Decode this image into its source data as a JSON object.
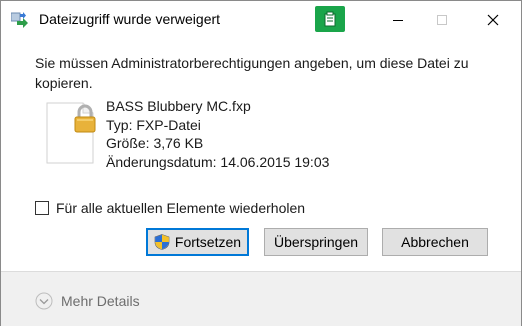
{
  "window": {
    "title": "Dateizugriff wurde verweigert",
    "caption_buttons": {
      "minimize": "─",
      "maximize": "☐",
      "close": "✕"
    }
  },
  "message": "Sie müssen Administratorberechtigungen angeben, um diese Datei zu kopieren.",
  "file": {
    "name": "BASS Blubbery MC.fxp",
    "type": "Typ: FXP-Datei",
    "size": "Größe: 3,76 KB",
    "modified": "Änderungsdatum: 14.06.2015 19:03"
  },
  "checkbox": {
    "label": "Für alle aktuellen Elemente wiederholen",
    "checked": false
  },
  "buttons": {
    "continue": "Fortsetzen",
    "skip": "Überspringen",
    "cancel": "Abbrechen"
  },
  "footer": {
    "more_details": "Mehr Details"
  },
  "colors": {
    "accent": "#0078d7",
    "green_tab": "#1aa54a",
    "lock": "#e8b23a",
    "footer_bg": "#f0f0f0"
  },
  "icons": [
    "copy-arrows-icon",
    "clipboard-icon",
    "minimize-icon",
    "maximize-icon",
    "close-icon",
    "file-icon",
    "lock-icon",
    "uac-shield-icon",
    "chevron-down-icon"
  ]
}
